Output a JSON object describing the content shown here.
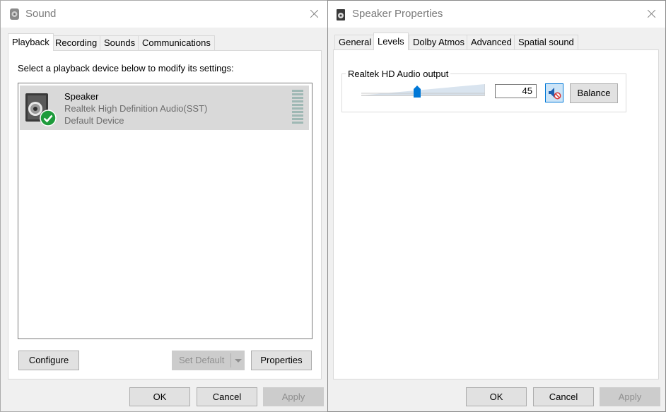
{
  "sound_window": {
    "title": "Sound",
    "tabs": [
      {
        "label": "Playback",
        "active": true
      },
      {
        "label": "Recording"
      },
      {
        "label": "Sounds"
      },
      {
        "label": "Communications"
      }
    ],
    "instruction": "Select a playback device below to modify its settings:",
    "device": {
      "name": "Speaker",
      "driver": "Realtek High Definition Audio(SST)",
      "status": "Default Device"
    },
    "buttons": {
      "configure": "Configure",
      "set_default": "Set Default",
      "properties": "Properties",
      "ok": "OK",
      "cancel": "Cancel",
      "apply": "Apply"
    }
  },
  "speaker_window": {
    "title": "Speaker Properties",
    "tabs": [
      {
        "label": "General"
      },
      {
        "label": "Levels",
        "active": true
      },
      {
        "label": "Dolby Atmos"
      },
      {
        "label": "Advanced"
      },
      {
        "label": "Spatial sound"
      }
    ],
    "levels": {
      "group_label": "Realtek HD Audio output",
      "volume": "45",
      "balance_label": "Balance"
    },
    "buttons": {
      "ok": "OK",
      "cancel": "Cancel",
      "apply": "Apply"
    }
  },
  "colors": {
    "accent": "#0078d7",
    "success": "#1e9b3c",
    "disabled_text": "#8f8f8f"
  }
}
